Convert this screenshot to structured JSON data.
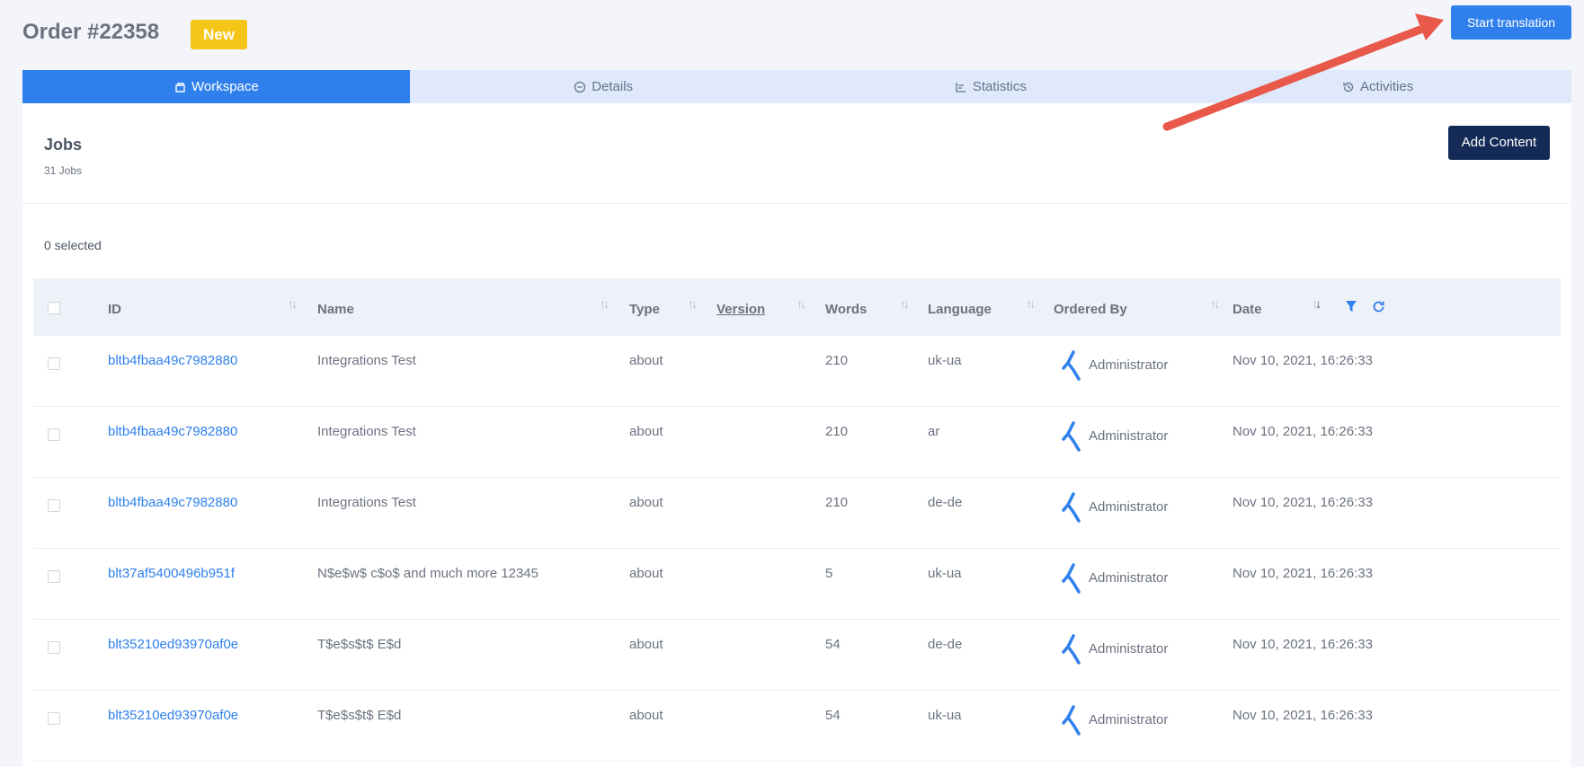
{
  "header": {
    "title": "Order #22358",
    "badge": "New",
    "start_button": "Start translation"
  },
  "tabs": [
    {
      "label": "Workspace",
      "icon": "workspace-icon",
      "active": true
    },
    {
      "label": "Details",
      "icon": "details-icon",
      "active": false
    },
    {
      "label": "Statistics",
      "icon": "statistics-icon",
      "active": false
    },
    {
      "label": "Activities",
      "icon": "history-icon",
      "active": false
    }
  ],
  "jobs": {
    "title": "Jobs",
    "count": "31 Jobs",
    "add_button": "Add Content",
    "selected": "0 selected"
  },
  "table": {
    "columns": [
      "ID",
      "Name",
      "Type",
      "Version",
      "Words",
      "Language",
      "Ordered By",
      "Date"
    ],
    "rows": [
      {
        "id": "bltb4fbaa49c7982880",
        "name": "Integrations Test",
        "type": "about",
        "words": "210",
        "language": "uk-ua",
        "ordered_by": "Administrator",
        "date": "Nov 10, 2021, 16:26:33"
      },
      {
        "id": "bltb4fbaa49c7982880",
        "name": "Integrations Test",
        "type": "about",
        "words": "210",
        "language": "ar",
        "ordered_by": "Administrator",
        "date": "Nov 10, 2021, 16:26:33"
      },
      {
        "id": "bltb4fbaa49c7982880",
        "name": "Integrations Test",
        "type": "about",
        "words": "210",
        "language": "de-de",
        "ordered_by": "Administrator",
        "date": "Nov 10, 2021, 16:26:33"
      },
      {
        "id": "blt37af5400496b951f",
        "name": "N$e$w$ c$o$ and much more 12345",
        "type": "about",
        "words": "5",
        "language": "uk-ua",
        "ordered_by": "Administrator",
        "date": "Nov 10, 2021, 16:26:33"
      },
      {
        "id": "blt35210ed93970af0e",
        "name": "T$e$s$t$ E$d",
        "type": "about",
        "words": "54",
        "language": "de-de",
        "ordered_by": "Administrator",
        "date": "Nov 10, 2021, 16:26:33"
      },
      {
        "id": "blt35210ed93970af0e",
        "name": "T$e$s$t$ E$d",
        "type": "about",
        "words": "54",
        "language": "uk-ua",
        "ordered_by": "Administrator",
        "date": "Nov 10, 2021, 16:26:33"
      }
    ]
  },
  "colors": {
    "accent": "#2f80ed",
    "badge": "#f5c518",
    "add_button": "#142b57",
    "annotation_arrow": "#e8594a"
  }
}
